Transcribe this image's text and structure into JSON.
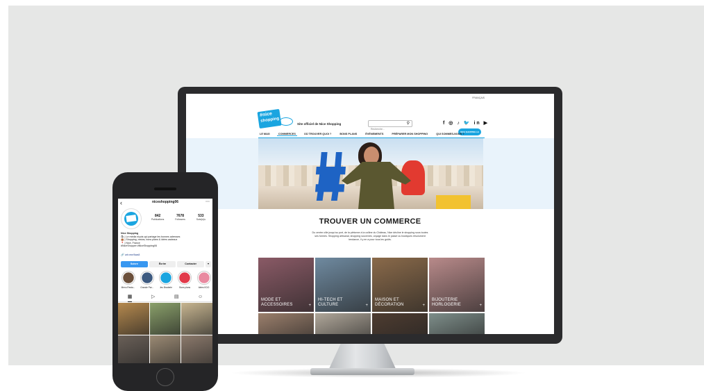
{
  "desktop": {
    "language": "FRANÇAIS",
    "logo": {
      "line1": "#nice",
      "line2": "shopping"
    },
    "tagline": "Site officiel de Nice Shopping",
    "search": {
      "placeholder": "Recherche..."
    },
    "socials": [
      "f",
      "◎",
      "♪",
      "🐦",
      "in",
      "▶"
    ],
    "cta": "NICE SHOPPING LE MAG",
    "nav": [
      "LE MAG",
      "COMMERCES",
      "OÙ TROUVER QUOI ?",
      "BONS PLANS",
      "ÉVÉNEMENTS",
      "PRÉPARER MON SHOPPING",
      "QUI SOMMES-NOUS ?"
    ],
    "nav_active_index": 1,
    "heading": "TROUVER UN COMMERCE",
    "intro": "Du centre-ville jusqu'au port, de la piétonne à la colline du Château, Nice décline le shopping sous toutes ses formes. Shopping artisanal, shopping souvenirs, voyage dans le passé ou boutiques résolument tendance, il y en a pour tous les goûts.",
    "categories": [
      {
        "line1": "MODE ET",
        "line2": "ACCESSOIRES",
        "color": "#8a5a66"
      },
      {
        "line1": "HI-TECH ET",
        "line2": "CULTURE",
        "color": "#6f8aa0"
      },
      {
        "line1": "MAISON ET",
        "line2": "DÉCORATION",
        "color": "#8a6a4a"
      },
      {
        "line1": "BIJOUTERIE",
        "line2": "HORLOGERIE",
        "color": "#b88a8a"
      }
    ],
    "more_tile_colors": [
      "#9b7f6c",
      "#b0a79a",
      "#4e3c30",
      "#7e8e8a"
    ]
  },
  "instagram": {
    "username": "niceshopping06",
    "stats": [
      {
        "value": "842",
        "label": "Publications"
      },
      {
        "value": "7678",
        "label": "Followers"
      },
      {
        "value": "533",
        "label": "Suivi(e)s"
      }
    ],
    "bio": {
      "name": "Nice Shopping",
      "line1": "🛍 | Le média niçois qui partage les bonnes adresses",
      "line2": "👜 | Shopping, restos, bons plans & idées cadeaux",
      "line3": "📍 | Nice, France",
      "line4": "#NiceShopper #NiceShopping06"
    },
    "link": "urlr.me/6ws8",
    "buttons": {
      "follow": "Suivre",
      "message": "Écrire",
      "contact": "Contacter"
    },
    "highlights": [
      {
        "label": "Menu Resta...",
        "color": "#6b4f3a"
      },
      {
        "label": "Grande Par...",
        "color": "#3d5a80"
      },
      {
        "label": "Jeu Braderie",
        "color": "#1aa5e0"
      },
      {
        "label": "Bons plans",
        "color": "#e23a4a"
      },
      {
        "label": "Idées KDO",
        "color": "#e98aa0"
      }
    ],
    "feed_colors": [
      "#b5894e",
      "#8aa06a",
      "#c7b590",
      "#6a6058",
      "#9b8a74",
      "#8c7a6c"
    ]
  }
}
